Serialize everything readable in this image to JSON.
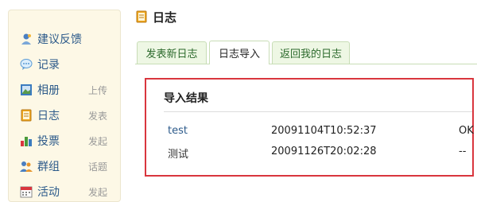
{
  "sidebar": {
    "items": [
      {
        "label": "建议反馈",
        "extra": "",
        "icon": "feedback-person-icon"
      },
      {
        "label": "记录",
        "extra": "",
        "icon": "speech-bubble-icon"
      },
      {
        "label": "相册",
        "extra": "上传",
        "icon": "photo-album-icon"
      },
      {
        "label": "日志",
        "extra": "发表",
        "icon": "notebook-icon"
      },
      {
        "label": "投票",
        "extra": "发起",
        "icon": "bar-chart-icon"
      },
      {
        "label": "群组",
        "extra": "话题",
        "icon": "group-people-icon"
      },
      {
        "label": "活动",
        "extra": "发起",
        "icon": "calendar-icon"
      }
    ]
  },
  "header": {
    "title": "日志",
    "icon": "notebook-icon"
  },
  "tabs": [
    {
      "label": "发表新日志",
      "active": false
    },
    {
      "label": "日志导入",
      "active": true
    },
    {
      "label": "返回我的日志",
      "active": false
    }
  ],
  "result": {
    "title": "导入结果",
    "rows": [
      {
        "name": "test",
        "time": "20091104T10:52:37",
        "status": "OK"
      },
      {
        "name": "测试",
        "time": "20091126T20:02:28",
        "status": "--"
      }
    ]
  },
  "colors": {
    "accent_red": "#d9363e",
    "link_blue": "#2c5a8a",
    "tab_green": "#eef7e4"
  }
}
